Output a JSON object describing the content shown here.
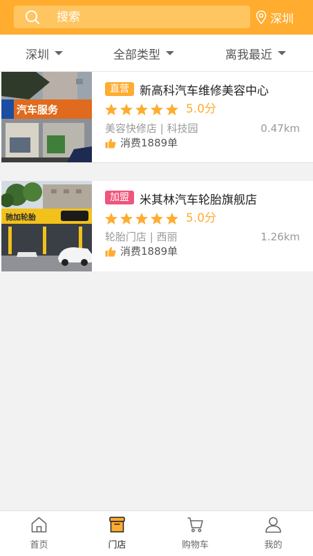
{
  "header": {
    "search_placeholder": "搜索",
    "location": "深圳"
  },
  "filters": {
    "city": "深圳",
    "type": "全部类型",
    "sort": "离我最近"
  },
  "stores": [
    {
      "tag": "直营",
      "tag_color": "#ffac2f",
      "name": "新高科汽车维修美容中心",
      "rating": "5.0分",
      "stars": 5,
      "category": "美容快修店 | 科技园",
      "distance": "0.47km",
      "sales": "消费1889单",
      "sign_text": "汽车服务"
    },
    {
      "tag": "加盟",
      "tag_color": "#f0557a",
      "name": "米其林汽车轮胎旗舰店",
      "rating": "5.0分",
      "stars": 5,
      "category": "轮胎门店 | 西丽",
      "distance": "1.26km",
      "sales": "消费1889单",
      "sign_text": "驰加轮胎"
    }
  ],
  "tabs": [
    {
      "label": "首页",
      "icon": "home-icon"
    },
    {
      "label": "门店",
      "icon": "store-icon"
    },
    {
      "label": "购物车",
      "icon": "cart-icon"
    },
    {
      "label": "我的",
      "icon": "user-icon"
    }
  ],
  "colors": {
    "accent": "#ffac2f",
    "tag_direct": "#ffac2f",
    "tag_franchise": "#f0557a"
  }
}
